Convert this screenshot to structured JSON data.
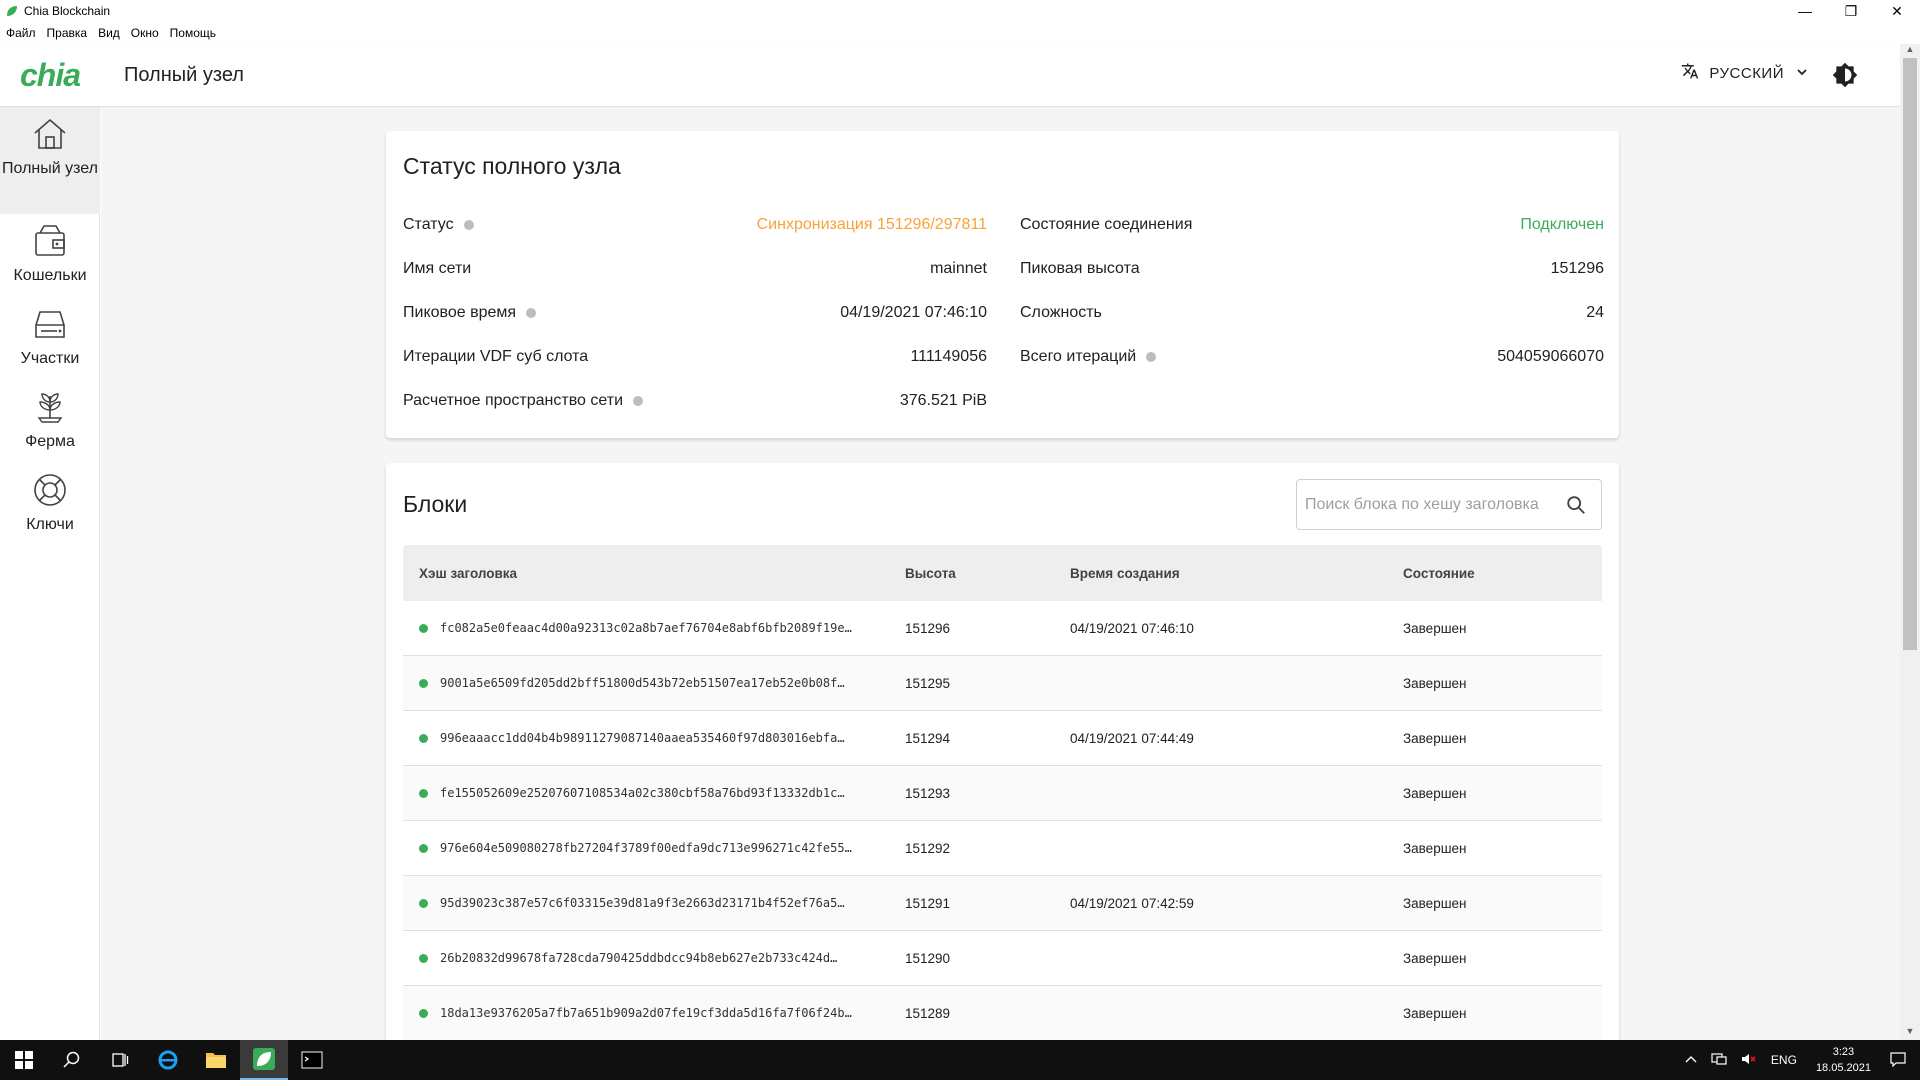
{
  "window": {
    "title": "Chia Blockchain",
    "controls": {
      "minimize": "—",
      "restore": "❐",
      "close": "✕"
    }
  },
  "menu": [
    "Файл",
    "Правка",
    "Вид",
    "Окно",
    "Помощь"
  ],
  "header": {
    "logo": "chia",
    "page_title": "Полный узел",
    "language": "РУССКИЙ",
    "brand_color": "#3aac59"
  },
  "sidebar": {
    "items": [
      {
        "label": "Полный узел",
        "icon": "home-icon",
        "active": true
      },
      {
        "label": "Кошельки",
        "icon": "wallet-icon",
        "active": false
      },
      {
        "label": "Участки",
        "icon": "storage-icon",
        "active": false
      },
      {
        "label": "Ферма",
        "icon": "sprout-icon",
        "active": false
      },
      {
        "label": "Ключи",
        "icon": "lifebuoy-icon",
        "active": false
      }
    ]
  },
  "status": {
    "title": "Статус полного узла",
    "left": [
      {
        "label": "Статус",
        "help": true,
        "value": "Синхронизация 151296/297811",
        "tone": "warn"
      },
      {
        "label": "Имя сети",
        "help": false,
        "value": "mainnet",
        "tone": ""
      },
      {
        "label": "Пиковое время",
        "help": true,
        "value": "04/19/2021 07:46:10",
        "tone": ""
      },
      {
        "label": "Итерации VDF суб слота",
        "help": false,
        "value": "111149056",
        "tone": ""
      },
      {
        "label": "Расчетное пространство сети",
        "help": true,
        "value": "376.521 PiB",
        "tone": ""
      }
    ],
    "right": [
      {
        "label": "Состояние соединения",
        "help": false,
        "value": "Подключен",
        "tone": "ok"
      },
      {
        "label": "Пиковая высота",
        "help": false,
        "value": "151296",
        "tone": ""
      },
      {
        "label": "Сложность",
        "help": false,
        "value": "24",
        "tone": ""
      },
      {
        "label": "Всего итераций",
        "help": true,
        "value": "504059066070",
        "tone": ""
      }
    ],
    "colors": {
      "warn": "#f7a33a",
      "ok": "#3aac59"
    }
  },
  "blocks": {
    "title": "Блоки",
    "search_placeholder": "Поиск блока по хешу заголовка",
    "columns": [
      "Хэш заголовка",
      "Высота",
      "Время создания",
      "Состояние"
    ],
    "rows": [
      {
        "hash": "fc082a5e0feaac4d00a92313c02a8b7aef76704e8abf6bfb2089f19e…",
        "height": "151296",
        "time": "04/19/2021 07:46:10",
        "state": "Завершен"
      },
      {
        "hash": "9001a5e6509fd205dd2bff51800d543b72eb51507ea17eb52e0b08f…",
        "height": "151295",
        "time": "",
        "state": "Завершен"
      },
      {
        "hash": "996eaaacc1dd04b4b98911279087140aaea535460f97d803016ebfa…",
        "height": "151294",
        "time": "04/19/2021 07:44:49",
        "state": "Завершен"
      },
      {
        "hash": "fe155052609e25207607108534a02c380cbf58a76bd93f13332db1c…",
        "height": "151293",
        "time": "",
        "state": "Завершен"
      },
      {
        "hash": "976e604e509080278fb27204f3789f00edfa9dc713e996271c42fe55…",
        "height": "151292",
        "time": "",
        "state": "Завершен"
      },
      {
        "hash": "95d39023c387e57c6f03315e39d81a9f3e2663d23171b4f52ef76a5…",
        "height": "151291",
        "time": "04/19/2021 07:42:59",
        "state": "Завершен"
      },
      {
        "hash": "26b20832d99678fa728cda790425ddbdcc94b8eb627e2b733c424d…",
        "height": "151290",
        "time": "",
        "state": "Завершен"
      },
      {
        "hash": "18da13e9376205a7fb7a651b909a2d07fe19cf3dda5d16fa7f06f24b…",
        "height": "151289",
        "time": "",
        "state": "Завершен"
      }
    ]
  },
  "taskbar": {
    "lang": "ENG",
    "time": "3:23",
    "date": "18.05.2021"
  }
}
